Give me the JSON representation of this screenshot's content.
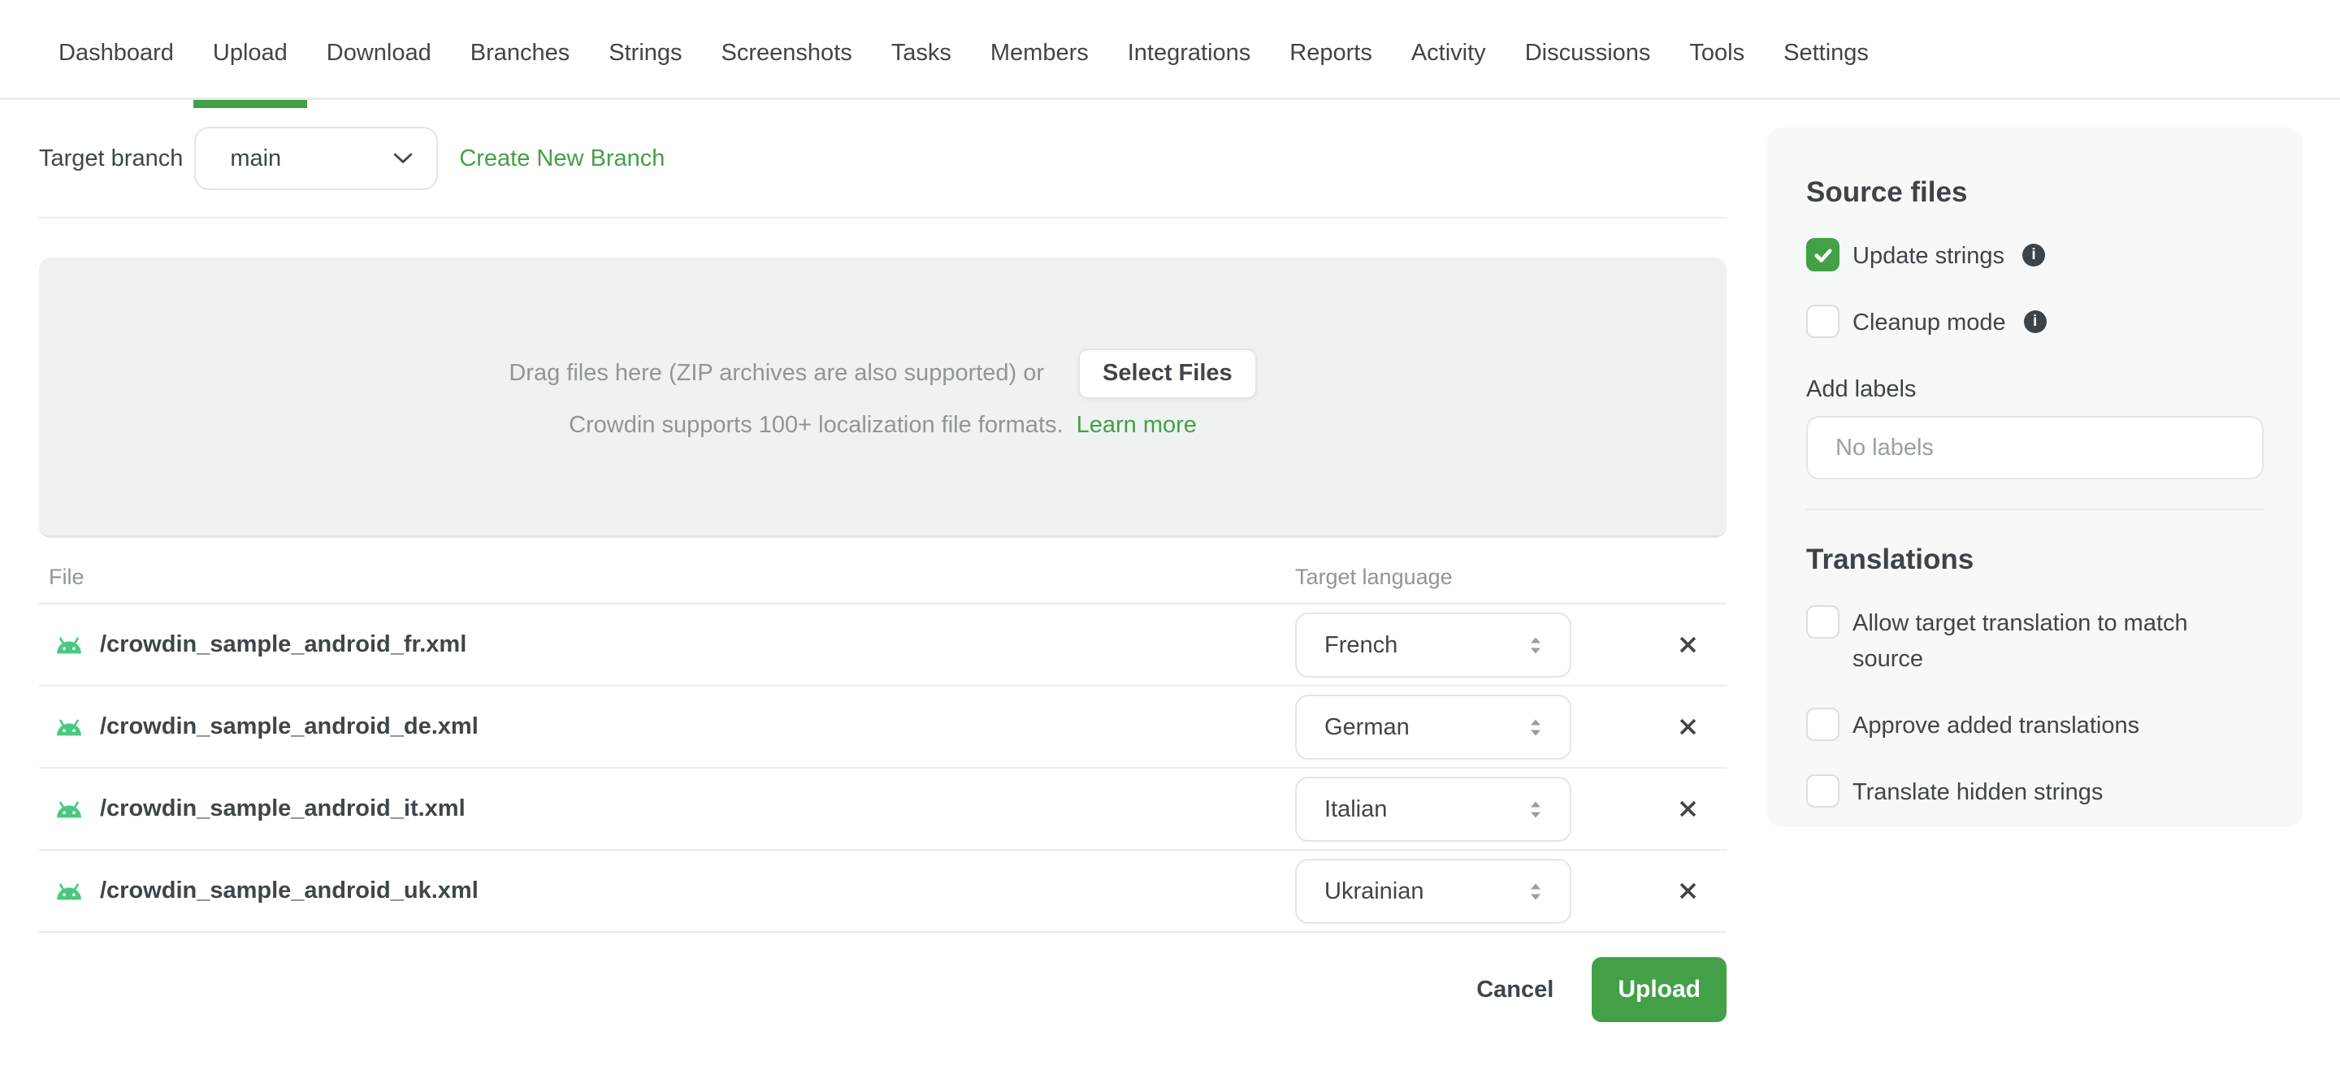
{
  "nav": {
    "items": [
      {
        "label": "Dashboard",
        "active": false
      },
      {
        "label": "Upload",
        "active": true
      },
      {
        "label": "Download",
        "active": false
      },
      {
        "label": "Branches",
        "active": false
      },
      {
        "label": "Strings",
        "active": false
      },
      {
        "label": "Screenshots",
        "active": false
      },
      {
        "label": "Tasks",
        "active": false
      },
      {
        "label": "Members",
        "active": false
      },
      {
        "label": "Integrations",
        "active": false
      },
      {
        "label": "Reports",
        "active": false
      },
      {
        "label": "Activity",
        "active": false
      },
      {
        "label": "Discussions",
        "active": false
      },
      {
        "label": "Tools",
        "active": false
      },
      {
        "label": "Settings",
        "active": false
      }
    ]
  },
  "toolbar": {
    "target_branch_label": "Target branch",
    "branch_value": "main",
    "create_branch_label": "Create New Branch"
  },
  "dropzone": {
    "drag_text": "Drag files here (ZIP archives are also supported) or",
    "select_files_label": "Select Files",
    "formats_text": "Crowdin supports 100+ localization file formats.",
    "learn_more_label": "Learn more"
  },
  "files_table": {
    "columns": {
      "file": "File",
      "target_language": "Target language"
    },
    "rows": [
      {
        "file": "/crowdin_sample_android_fr.xml",
        "language": "French"
      },
      {
        "file": "/crowdin_sample_android_de.xml",
        "language": "German"
      },
      {
        "file": "/crowdin_sample_android_it.xml",
        "language": "Italian"
      },
      {
        "file": "/crowdin_sample_android_uk.xml",
        "language": "Ukrainian"
      }
    ]
  },
  "footer": {
    "cancel_label": "Cancel",
    "upload_label": "Upload"
  },
  "sidebar": {
    "source_files": {
      "title": "Source files",
      "options": [
        {
          "label": "Update strings",
          "checked": true,
          "info": true
        },
        {
          "label": "Cleanup mode",
          "checked": false,
          "info": true
        }
      ],
      "add_labels_label": "Add labels",
      "labels_placeholder": "No labels"
    },
    "translations": {
      "title": "Translations",
      "options": [
        {
          "label": "Allow target translation to match source",
          "checked": false,
          "info": false
        },
        {
          "label": "Approve added translations",
          "checked": false,
          "info": false
        },
        {
          "label": "Translate hidden strings",
          "checked": false,
          "info": false
        }
      ]
    }
  },
  "colors": {
    "accent_green": "#43a047",
    "android_green": "#4bc880",
    "dark_text": "#3e464a",
    "muted_text": "#8f9795"
  }
}
